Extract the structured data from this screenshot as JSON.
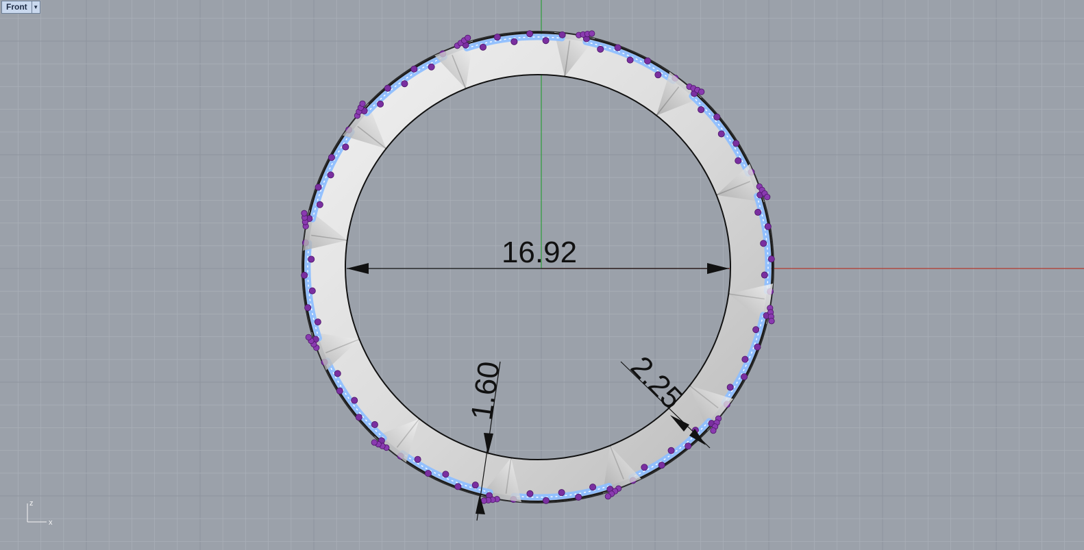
{
  "viewport": {
    "name": "Front",
    "menu_icon": "triangle-down-icon"
  },
  "dimensions": {
    "diameter": "16.92",
    "band_thickness": "1.60",
    "stone_height": "2.25"
  },
  "axis_gizmo": {
    "z_label": "z",
    "x_label": "x"
  },
  "colors": {
    "background": "#9ba1aa",
    "grid_minor": "#a9afb8",
    "grid_major": "#8e949d",
    "x_axis": "#b23a2f",
    "z_axis": "#2d9e3a",
    "band_metal": "#dadada",
    "gem_blue": "#8fbfff",
    "prong_purple": "#7a2fa0"
  }
}
